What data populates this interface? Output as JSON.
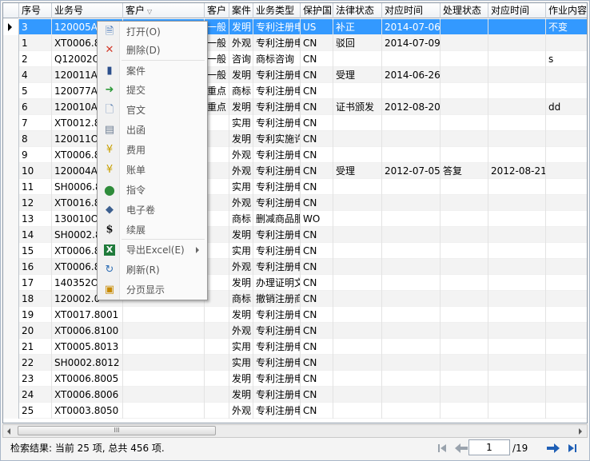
{
  "grid": {
    "columns": [
      "序号",
      "业务号",
      "客户",
      "客户",
      "案件",
      "业务类型",
      "保护国",
      "法律状态",
      "对应时间",
      "处理状态",
      "对应时间",
      "作业内容"
    ],
    "rows": [
      [
        "3",
        "120005A",
        "",
        "一般",
        "发明",
        "专利注册申",
        "US",
        "补正",
        "2014-07-06",
        "",
        "",
        "不变"
      ],
      [
        "1",
        "XT0006.8",
        "",
        "一般",
        "外观",
        "专利注册申",
        "CN",
        "驳回",
        "2014-07-09",
        "",
        "",
        ""
      ],
      [
        "2",
        "Q12002Q",
        "",
        "一般",
        "咨询",
        "商标咨询",
        "CN",
        "",
        "",
        "",
        "",
        "s"
      ],
      [
        "4",
        "120011A",
        "",
        "一般",
        "发明",
        "专利注册申",
        "CN",
        "受理",
        "2014-06-26",
        "",
        "",
        ""
      ],
      [
        "5",
        "120077A",
        "",
        "重点",
        "商标",
        "专利注册申",
        "CN",
        "",
        "",
        "",
        "",
        ""
      ],
      [
        "6",
        "120010A",
        "",
        "重点",
        "发明",
        "专利注册申",
        "CN",
        "证书颁发",
        "2012-08-20",
        "",
        "",
        "dd"
      ],
      [
        "7",
        "XT0012.8",
        "",
        "",
        "实用",
        "专利注册申",
        "CN",
        "",
        "",
        "",
        "",
        ""
      ],
      [
        "8",
        "120011O",
        "",
        "",
        "发明",
        "专利实施许",
        "CN",
        "",
        "",
        "",
        "",
        ""
      ],
      [
        "9",
        "XT0006.8",
        "",
        "",
        "外观",
        "专利注册申",
        "CN",
        "",
        "",
        "",
        "",
        ""
      ],
      [
        "10",
        "120004A",
        "",
        "",
        "外观",
        "专利注册申",
        "CN",
        "受理",
        "2012-07-05",
        "答复",
        "2012-08-21",
        ""
      ],
      [
        "11",
        "SH0006.8",
        "",
        "",
        "实用",
        "专利注册申",
        "CN",
        "",
        "",
        "",
        "",
        ""
      ],
      [
        "12",
        "XT0016.8",
        "",
        "",
        "外观",
        "专利注册申",
        "CN",
        "",
        "",
        "",
        "",
        ""
      ],
      [
        "13",
        "130010O",
        "",
        "",
        "商标",
        "删减商品服",
        "WO",
        "",
        "",
        "",
        "",
        ""
      ],
      [
        "14",
        "SH0002.8",
        "",
        "",
        "发明",
        "专利注册申",
        "CN",
        "",
        "",
        "",
        "",
        ""
      ],
      [
        "15",
        "XT0006.8",
        "",
        "",
        "实用",
        "专利注册申",
        "CN",
        "",
        "",
        "",
        "",
        ""
      ],
      [
        "16",
        "XT0006.8",
        "",
        "",
        "外观",
        "专利注册申",
        "CN",
        "",
        "",
        "",
        "",
        ""
      ],
      [
        "17",
        "140352O",
        "",
        "",
        "发明",
        "办理证明文",
        "CN",
        "",
        "",
        "",
        "",
        ""
      ],
      [
        "18",
        "120002.0",
        "",
        "",
        "商标",
        "撤销注册商",
        "CN",
        "",
        "",
        "",
        "",
        ""
      ],
      [
        "19",
        "XT0017.8001",
        "",
        "",
        "发明",
        "专利注册申",
        "CN",
        "",
        "",
        "",
        "",
        ""
      ],
      [
        "20",
        "XT0006.8100",
        "",
        "",
        "外观",
        "专利注册申",
        "CN",
        "",
        "",
        "",
        "",
        ""
      ],
      [
        "21",
        "XT0005.8013",
        "",
        "",
        "实用",
        "专利注册申",
        "CN",
        "",
        "",
        "",
        "",
        ""
      ],
      [
        "22",
        "SH0002.8012",
        "",
        "",
        "实用",
        "专利注册申",
        "CN",
        "",
        "",
        "",
        "",
        ""
      ],
      [
        "23",
        "XT0006.8005",
        "",
        "",
        "发明",
        "专利注册申",
        "CN",
        "",
        "",
        "",
        "",
        ""
      ],
      [
        "24",
        "XT0006.8006",
        "",
        "",
        "发明",
        "专利注册申",
        "CN",
        "",
        "",
        "",
        "",
        ""
      ],
      [
        "25",
        "XT0003.8050",
        "",
        "",
        "外观",
        "专利注册申",
        "CN",
        "",
        "",
        "",
        "",
        ""
      ]
    ]
  },
  "context_menu": {
    "items": [
      {
        "label": "打开(O)",
        "icon": "open-icon",
        "icon_glyph": "🗎",
        "icon_color": "#3a6fb5"
      },
      {
        "label": "删除(D)",
        "icon": "delete-icon",
        "icon_glyph": "✕",
        "icon_color": "#d23a2a"
      },
      {
        "label": "案件",
        "icon": "case-icon",
        "icon_glyph": "▮",
        "icon_color": "#2b4f8c"
      },
      {
        "label": "提交",
        "icon": "submit-icon",
        "icon_glyph": "➜",
        "icon_color": "#2e9a3a"
      },
      {
        "label": "官文",
        "icon": "document-icon",
        "icon_glyph": "🗋",
        "icon_color": "#5a7fb0"
      },
      {
        "label": "出函",
        "icon": "letter-icon",
        "icon_glyph": "▤",
        "icon_color": "#6f7f95"
      },
      {
        "label": "费用",
        "icon": "fee-icon",
        "icon_glyph": "¥",
        "icon_color": "#c9a000"
      },
      {
        "label": "账单",
        "icon": "bill-icon",
        "icon_glyph": "¥",
        "icon_color": "#c9a000"
      },
      {
        "label": "指令",
        "icon": "instruction-icon",
        "icon_glyph": "●",
        "icon_color": "#2e8b3a"
      },
      {
        "label": "电子卷",
        "icon": "ebook-icon",
        "icon_glyph": "◆",
        "icon_color": "#3c5f8f"
      },
      {
        "label": "续展",
        "icon": "renewal-icon",
        "icon_glyph": "$",
        "icon_color": "#111111"
      },
      {
        "label": "导出Excel(E)",
        "icon": "excel-icon",
        "icon_glyph": "X",
        "icon_color": "#1f7a3a"
      },
      {
        "label": "刷新(R)",
        "icon": "refresh-icon",
        "icon_glyph": "↻",
        "icon_color": "#2f6fb5"
      },
      {
        "label": "分页显示",
        "icon": "paging-icon",
        "icon_glyph": "▣",
        "icon_color": "#c88a00"
      }
    ]
  },
  "status": {
    "text": "检索结果: 当前 25 项, 总共 456 项.",
    "page": "1",
    "total": "/19"
  },
  "scrollbar": {
    "thumb_grip": "III"
  },
  "colors": {
    "selection": "#3399ff",
    "header_bg": "#eef1f5",
    "pager_blue": "#1f5fb5"
  }
}
